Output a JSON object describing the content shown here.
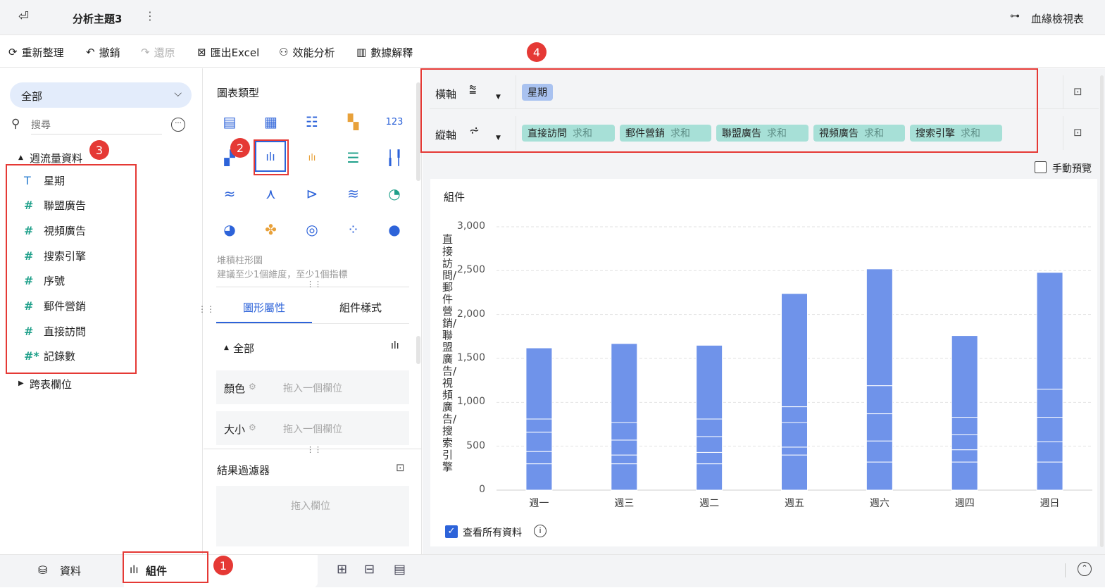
{
  "topbar": {
    "title": "分析主題3",
    "more_icon": "more-vertical-icon",
    "lineage_label": "血緣檢視表"
  },
  "toolbar": {
    "refresh_label": "重新整理",
    "undo_label": "撤銷",
    "redo_label": "還原",
    "export_label": "匯出Excel",
    "performance_label": "效能分析",
    "explain_label": "數據解釋"
  },
  "left": {
    "dataset_select": "全部",
    "search_placeholder": "搜尋",
    "table_name": "週流量資料",
    "fields": [
      {
        "icon": "T",
        "label": "星期"
      },
      {
        "icon": "#",
        "label": "聯盟廣告"
      },
      {
        "icon": "#",
        "label": "視頻廣告"
      },
      {
        "icon": "#",
        "label": "搜索引擎"
      },
      {
        "icon": "#",
        "label": "序號"
      },
      {
        "icon": "#",
        "label": "郵件營銷"
      },
      {
        "icon": "#",
        "label": "直接訪問"
      },
      {
        "icon": "#*",
        "label": "記錄數"
      }
    ],
    "cross_table": "跨表欄位"
  },
  "middle": {
    "chart_type_title": "圖表類型",
    "selected_type_name": "堆積柱形圖",
    "selected_type_hint": "建議至少1個維度，至少1個指標",
    "tab_graph_attr": "圖形屬性",
    "tab_component_style": "組件樣式",
    "all_label": "全部",
    "color_label": "顏色",
    "size_label": "大小",
    "drop_field_hint": "拖入一個欄位",
    "filter_title": "結果過濾器",
    "filter_drop_hint": "拖入欄位"
  },
  "axes": {
    "x_label": "橫軸",
    "y_label": "縱軸",
    "x_fields": [
      "星期"
    ],
    "y_fields": [
      {
        "name": "直接訪問",
        "agg": "求和"
      },
      {
        "name": "郵件營銷",
        "agg": "求和"
      },
      {
        "name": "聯盟廣告",
        "agg": "求和"
      },
      {
        "name": "視頻廣告",
        "agg": "求和"
      },
      {
        "name": "搜索引擎",
        "agg": "求和"
      }
    ]
  },
  "preview": {
    "manual_preview": "手動預覽",
    "component_title": "組件",
    "view_all": "查看所有資料"
  },
  "chart_data": {
    "type": "bar",
    "stacked": true,
    "ylabel": "直接訪問/郵件營銷/聯盟廣告/視頻廣告/搜索引擎",
    "ylim": [
      0,
      3000
    ],
    "yticks": [
      0,
      500,
      1000,
      1500,
      2000,
      2500,
      3000
    ],
    "ytick_labels": [
      "0",
      "500",
      "1,000",
      "1,500",
      "2,000",
      "2,500",
      "3,000"
    ],
    "grid": true,
    "color": "#6f93ea",
    "categories": [
      "週一",
      "週三",
      "週二",
      "週五",
      "週六",
      "週四",
      "週日"
    ],
    "series": [
      {
        "values": [
          300,
          300,
          300,
          400,
          320,
          320,
          320
        ]
      },
      {
        "values": [
          140,
          100,
          130,
          90,
          240,
          140,
          230
        ]
      },
      {
        "values": [
          220,
          170,
          180,
          280,
          310,
          170,
          280
        ]
      },
      {
        "values": [
          150,
          200,
          200,
          180,
          320,
          200,
          320
        ]
      },
      {
        "values": [
          810,
          900,
          840,
          1290,
          1330,
          930,
          1330
        ]
      }
    ]
  },
  "bottom": {
    "data_tab": "資料",
    "component_tab": "組件"
  },
  "badges": [
    "1",
    "2",
    "3",
    "4"
  ]
}
